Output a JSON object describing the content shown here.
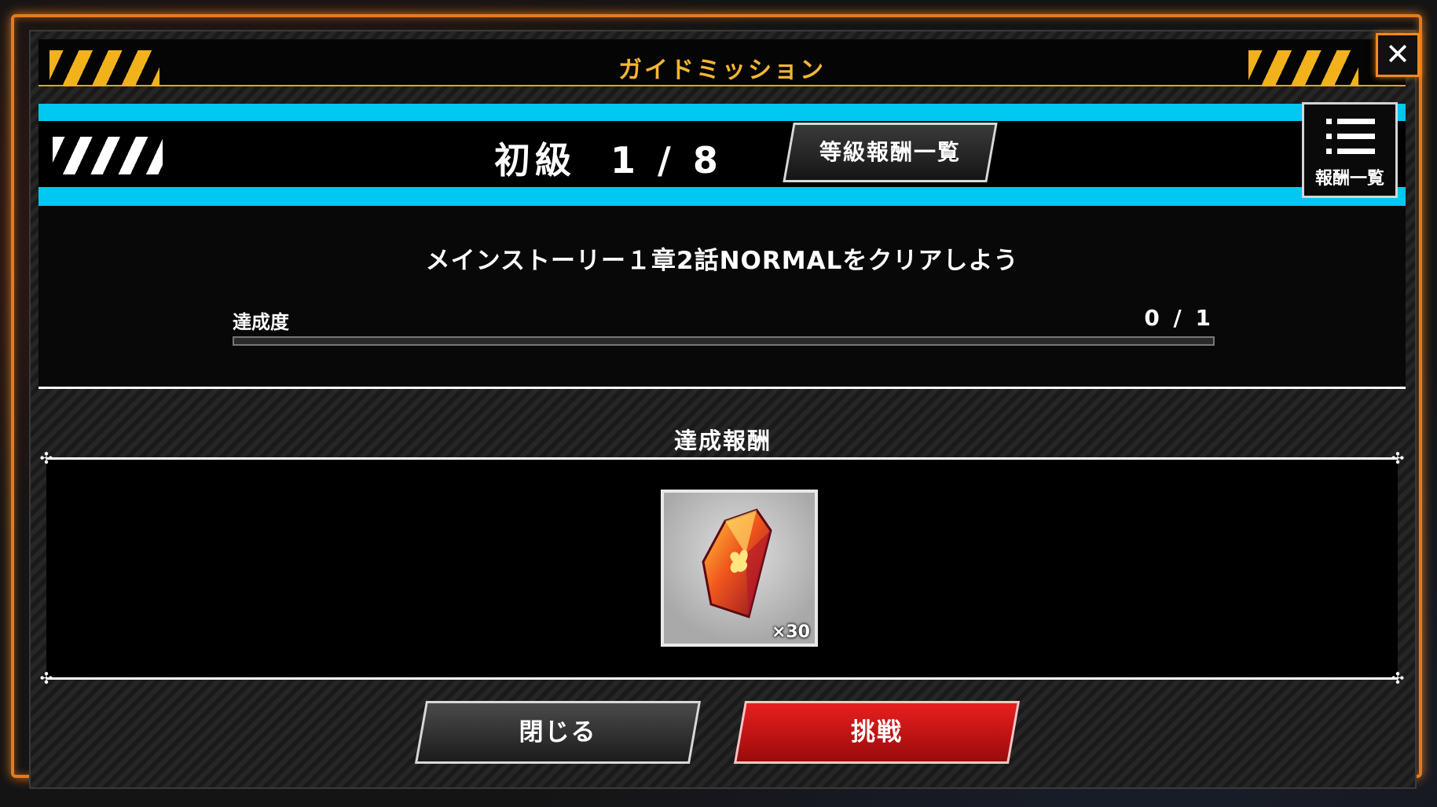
{
  "dialog": {
    "title": "ガイドミッション",
    "close_icon": "close-icon"
  },
  "level": {
    "rank": "初級",
    "progress": "1 / 8",
    "rank_reward_button": "等級報酬一覧",
    "reward_list_button": "報酬一覧",
    "reward_list_icon": "list-icon"
  },
  "mission": {
    "description": "メインストーリー１章2話NORMALをクリアしよう",
    "progress_label": "達成度",
    "progress_count": "0 / 1",
    "progress_fraction": 0
  },
  "reward": {
    "title": "達成報酬",
    "items": [
      {
        "icon": "red-crystal-icon",
        "quantity": "×30"
      }
    ]
  },
  "buttons": {
    "close": "閉じる",
    "challenge": "挑戦"
  },
  "colors": {
    "frame_accent": "#e8791a",
    "title_gold": "#f4b632",
    "level_band": "#00c8f0",
    "challenge_red": "#d21515"
  }
}
